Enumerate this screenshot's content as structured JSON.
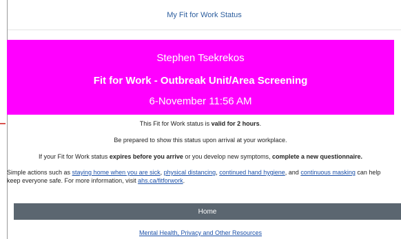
{
  "header": {
    "title": "My Fit for Work Status"
  },
  "banner": {
    "name": "Stephen Tsekrekos",
    "screening_title": "Fit for Work - Outbreak Unit/Area Screening",
    "datetime": "6-November 11:56 AM",
    "color": "#ff00ff"
  },
  "messages": {
    "validity_prefix": "This Fit for Work status is ",
    "validity_bold": "valid for 2 hours",
    "validity_suffix": ".",
    "prepared": "Be prepared to show this status upon arrival at your workplace.",
    "expiry_part1": "If your Fit for Work status ",
    "expiry_bold1": "expires before you arrive",
    "expiry_part2": " or you develop new symptoms, ",
    "expiry_bold2": "complete a new questionnaire."
  },
  "actions": {
    "prefix": "Simple actions such as ",
    "link_sick": "staying home when you are sick",
    "sep1": ", ",
    "link_distancing": "physical distancing",
    "sep2": ", ",
    "link_hygiene": "continued hand hygiene",
    "sep3": ", and ",
    "link_masking": "continuous masking",
    "middle": " can help keep everyone safe. For more information, visit ",
    "link_site": "ahs.ca/fitforwork",
    "end": "."
  },
  "home_button": {
    "label": "Home"
  },
  "footer": {
    "resources_link": "Mental Health, Privacy and Other Resources"
  }
}
